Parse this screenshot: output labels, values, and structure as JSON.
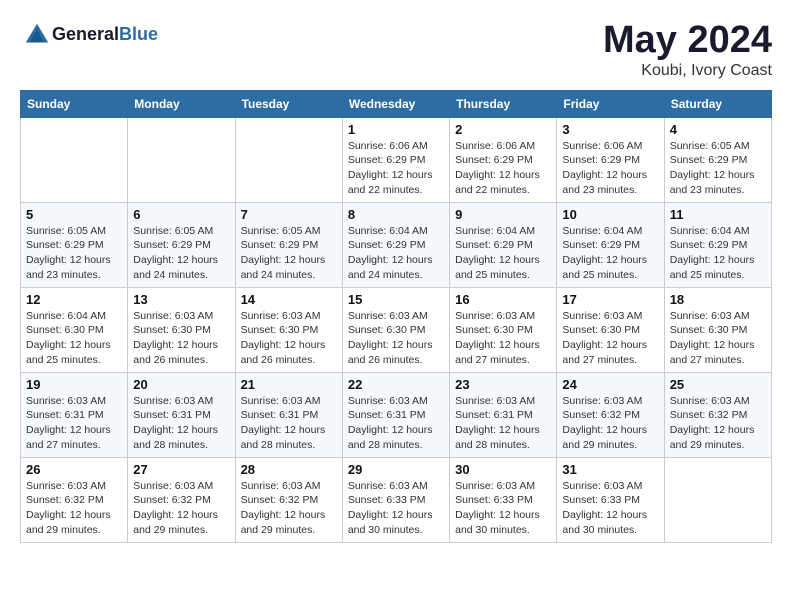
{
  "logo": {
    "text_general": "General",
    "text_blue": "Blue"
  },
  "title": "May 2024",
  "subtitle": "Koubi, Ivory Coast",
  "weekdays": [
    "Sunday",
    "Monday",
    "Tuesday",
    "Wednesday",
    "Thursday",
    "Friday",
    "Saturday"
  ],
  "weeks": [
    [
      {
        "day": "",
        "info": ""
      },
      {
        "day": "",
        "info": ""
      },
      {
        "day": "",
        "info": ""
      },
      {
        "day": "1",
        "info": "Sunrise: 6:06 AM\nSunset: 6:29 PM\nDaylight: 12 hours\nand 22 minutes."
      },
      {
        "day": "2",
        "info": "Sunrise: 6:06 AM\nSunset: 6:29 PM\nDaylight: 12 hours\nand 22 minutes."
      },
      {
        "day": "3",
        "info": "Sunrise: 6:06 AM\nSunset: 6:29 PM\nDaylight: 12 hours\nand 23 minutes."
      },
      {
        "day": "4",
        "info": "Sunrise: 6:05 AM\nSunset: 6:29 PM\nDaylight: 12 hours\nand 23 minutes."
      }
    ],
    [
      {
        "day": "5",
        "info": "Sunrise: 6:05 AM\nSunset: 6:29 PM\nDaylight: 12 hours\nand 23 minutes."
      },
      {
        "day": "6",
        "info": "Sunrise: 6:05 AM\nSunset: 6:29 PM\nDaylight: 12 hours\nand 24 minutes."
      },
      {
        "day": "7",
        "info": "Sunrise: 6:05 AM\nSunset: 6:29 PM\nDaylight: 12 hours\nand 24 minutes."
      },
      {
        "day": "8",
        "info": "Sunrise: 6:04 AM\nSunset: 6:29 PM\nDaylight: 12 hours\nand 24 minutes."
      },
      {
        "day": "9",
        "info": "Sunrise: 6:04 AM\nSunset: 6:29 PM\nDaylight: 12 hours\nand 25 minutes."
      },
      {
        "day": "10",
        "info": "Sunrise: 6:04 AM\nSunset: 6:29 PM\nDaylight: 12 hours\nand 25 minutes."
      },
      {
        "day": "11",
        "info": "Sunrise: 6:04 AM\nSunset: 6:29 PM\nDaylight: 12 hours\nand 25 minutes."
      }
    ],
    [
      {
        "day": "12",
        "info": "Sunrise: 6:04 AM\nSunset: 6:30 PM\nDaylight: 12 hours\nand 25 minutes."
      },
      {
        "day": "13",
        "info": "Sunrise: 6:03 AM\nSunset: 6:30 PM\nDaylight: 12 hours\nand 26 minutes."
      },
      {
        "day": "14",
        "info": "Sunrise: 6:03 AM\nSunset: 6:30 PM\nDaylight: 12 hours\nand 26 minutes."
      },
      {
        "day": "15",
        "info": "Sunrise: 6:03 AM\nSunset: 6:30 PM\nDaylight: 12 hours\nand 26 minutes."
      },
      {
        "day": "16",
        "info": "Sunrise: 6:03 AM\nSunset: 6:30 PM\nDaylight: 12 hours\nand 27 minutes."
      },
      {
        "day": "17",
        "info": "Sunrise: 6:03 AM\nSunset: 6:30 PM\nDaylight: 12 hours\nand 27 minutes."
      },
      {
        "day": "18",
        "info": "Sunrise: 6:03 AM\nSunset: 6:30 PM\nDaylight: 12 hours\nand 27 minutes."
      }
    ],
    [
      {
        "day": "19",
        "info": "Sunrise: 6:03 AM\nSunset: 6:31 PM\nDaylight: 12 hours\nand 27 minutes."
      },
      {
        "day": "20",
        "info": "Sunrise: 6:03 AM\nSunset: 6:31 PM\nDaylight: 12 hours\nand 28 minutes."
      },
      {
        "day": "21",
        "info": "Sunrise: 6:03 AM\nSunset: 6:31 PM\nDaylight: 12 hours\nand 28 minutes."
      },
      {
        "day": "22",
        "info": "Sunrise: 6:03 AM\nSunset: 6:31 PM\nDaylight: 12 hours\nand 28 minutes."
      },
      {
        "day": "23",
        "info": "Sunrise: 6:03 AM\nSunset: 6:31 PM\nDaylight: 12 hours\nand 28 minutes."
      },
      {
        "day": "24",
        "info": "Sunrise: 6:03 AM\nSunset: 6:32 PM\nDaylight: 12 hours\nand 29 minutes."
      },
      {
        "day": "25",
        "info": "Sunrise: 6:03 AM\nSunset: 6:32 PM\nDaylight: 12 hours\nand 29 minutes."
      }
    ],
    [
      {
        "day": "26",
        "info": "Sunrise: 6:03 AM\nSunset: 6:32 PM\nDaylight: 12 hours\nand 29 minutes."
      },
      {
        "day": "27",
        "info": "Sunrise: 6:03 AM\nSunset: 6:32 PM\nDaylight: 12 hours\nand 29 minutes."
      },
      {
        "day": "28",
        "info": "Sunrise: 6:03 AM\nSunset: 6:32 PM\nDaylight: 12 hours\nand 29 minutes."
      },
      {
        "day": "29",
        "info": "Sunrise: 6:03 AM\nSunset: 6:33 PM\nDaylight: 12 hours\nand 30 minutes."
      },
      {
        "day": "30",
        "info": "Sunrise: 6:03 AM\nSunset: 6:33 PM\nDaylight: 12 hours\nand 30 minutes."
      },
      {
        "day": "31",
        "info": "Sunrise: 6:03 AM\nSunset: 6:33 PM\nDaylight: 12 hours\nand 30 minutes."
      },
      {
        "day": "",
        "info": ""
      }
    ]
  ]
}
